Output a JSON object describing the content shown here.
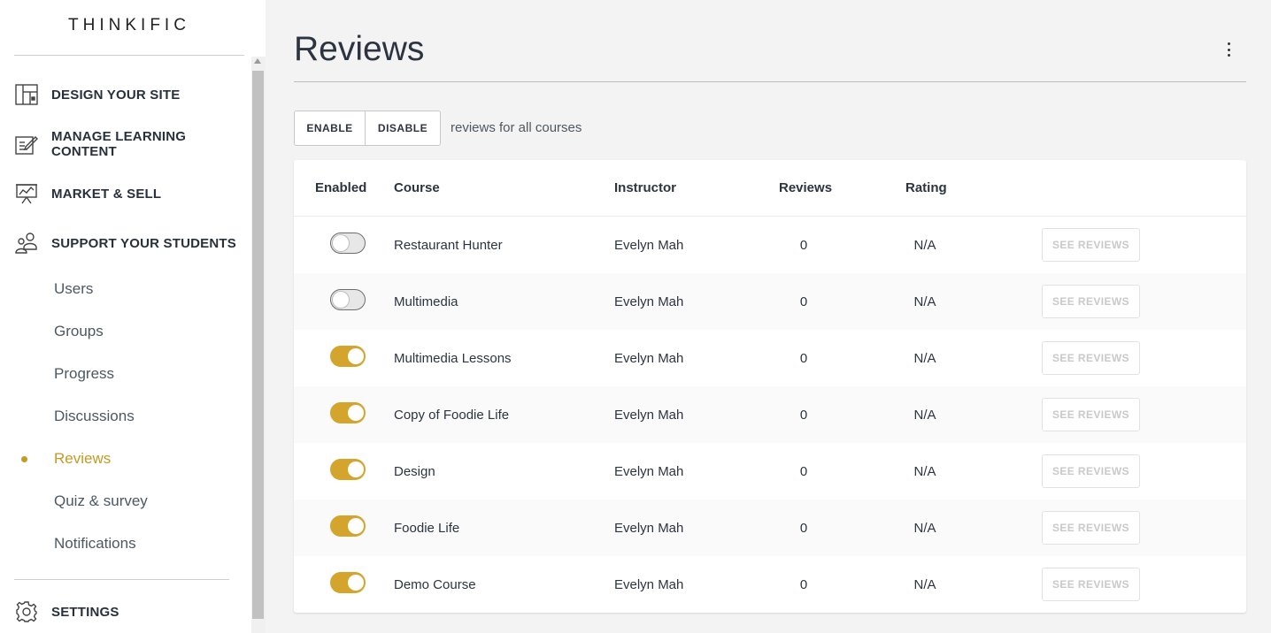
{
  "brand": {
    "logo_text": "THINKIFIC",
    "accent": "#c29a24"
  },
  "sidebar": {
    "main_items": [
      {
        "label": "DESIGN YOUR SITE",
        "icon": "layout-icon"
      },
      {
        "label": "MANAGE LEARNING CONTENT",
        "icon": "edit-icon"
      },
      {
        "label": "MARKET & SELL",
        "icon": "presentation-icon"
      },
      {
        "label": "SUPPORT YOUR STUDENTS",
        "icon": "users-icon"
      }
    ],
    "sub_items": [
      {
        "label": "Users",
        "active": false
      },
      {
        "label": "Groups",
        "active": false
      },
      {
        "label": "Progress",
        "active": false
      },
      {
        "label": "Discussions",
        "active": false
      },
      {
        "label": "Reviews",
        "active": true
      },
      {
        "label": "Quiz & survey",
        "active": false
      },
      {
        "label": "Notifications",
        "active": false
      }
    ],
    "settings": {
      "label": "SETTINGS",
      "icon": "gear-icon"
    }
  },
  "page": {
    "title": "Reviews",
    "enable_label": "ENABLE",
    "disable_label": "DISABLE",
    "bulk_text": "reviews for all courses"
  },
  "table": {
    "headers": {
      "enabled": "Enabled",
      "course": "Course",
      "instructor": "Instructor",
      "reviews": "Reviews",
      "rating": "Rating"
    },
    "rows": [
      {
        "enabled": false,
        "course": "Restaurant Hunter",
        "instructor": "Evelyn Mah",
        "reviews": "0",
        "rating": "N/A",
        "action": "SEE REVIEWS"
      },
      {
        "enabled": false,
        "course": "Multimedia",
        "instructor": "Evelyn Mah",
        "reviews": "0",
        "rating": "N/A",
        "action": "SEE REVIEWS"
      },
      {
        "enabled": true,
        "course": "Multimedia Lessons",
        "instructor": "Evelyn Mah",
        "reviews": "0",
        "rating": "N/A",
        "action": "SEE REVIEWS"
      },
      {
        "enabled": true,
        "course": "Copy of Foodie Life",
        "instructor": "Evelyn Mah",
        "reviews": "0",
        "rating": "N/A",
        "action": "SEE REVIEWS"
      },
      {
        "enabled": true,
        "course": "Design",
        "instructor": "Evelyn Mah",
        "reviews": "0",
        "rating": "N/A",
        "action": "SEE REVIEWS"
      },
      {
        "enabled": true,
        "course": "Foodie Life",
        "instructor": "Evelyn Mah",
        "reviews": "0",
        "rating": "N/A",
        "action": "SEE REVIEWS"
      },
      {
        "enabled": true,
        "course": "Demo Course",
        "instructor": "Evelyn Mah",
        "reviews": "0",
        "rating": "N/A",
        "action": "SEE REVIEWS"
      }
    ]
  }
}
